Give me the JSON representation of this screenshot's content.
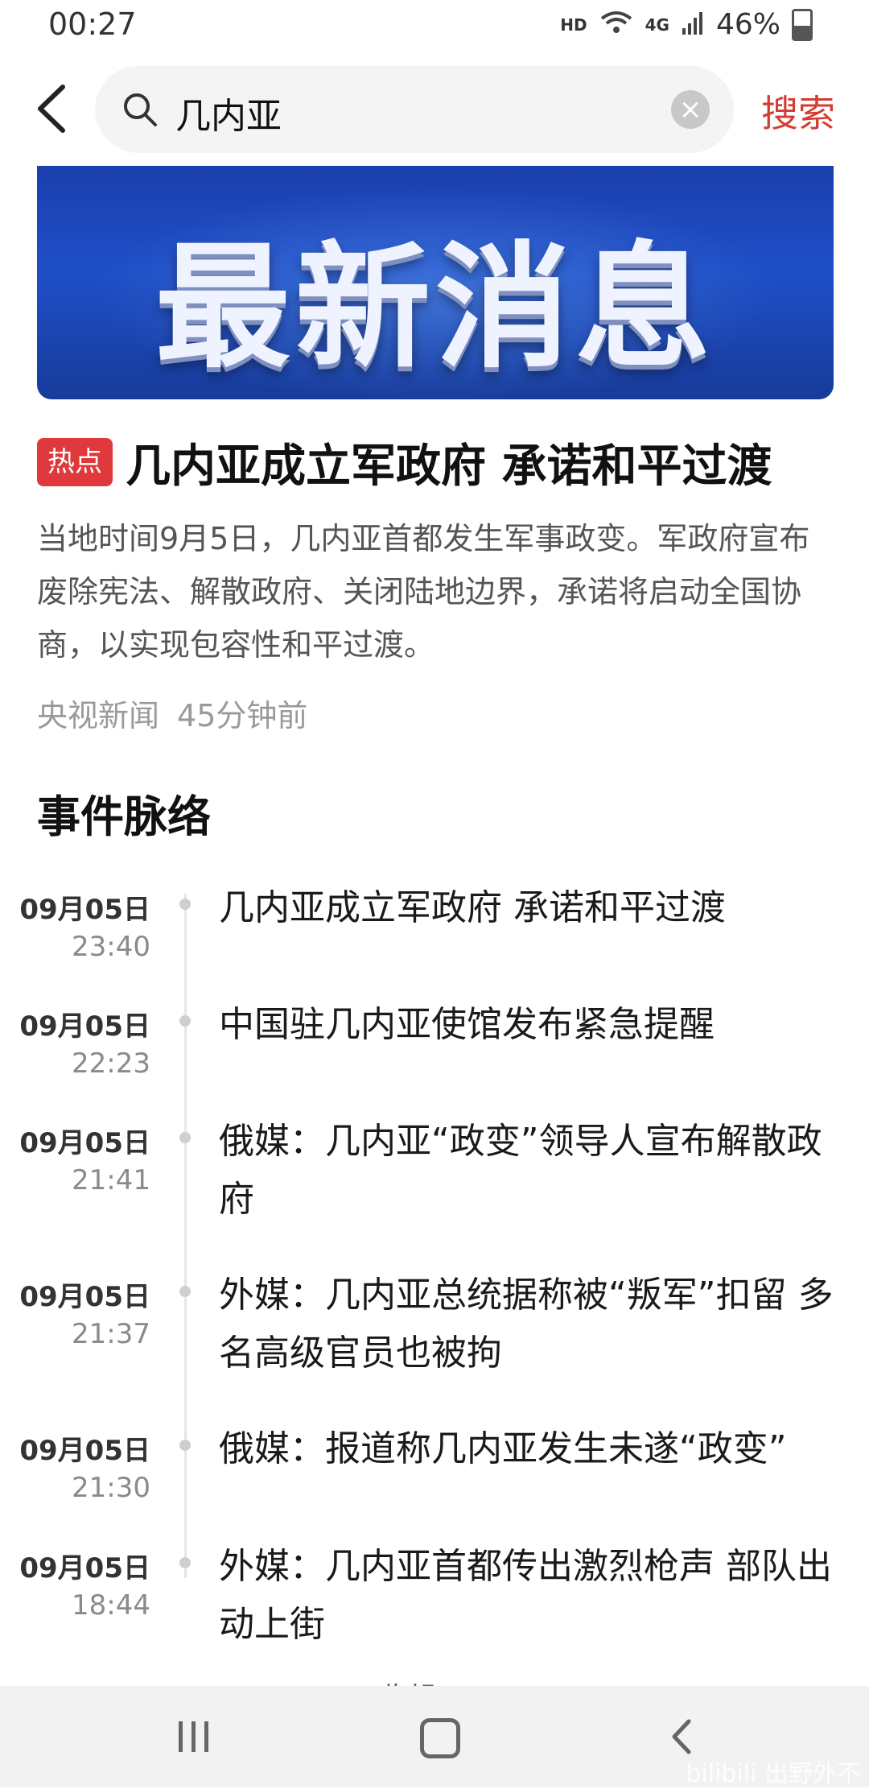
{
  "status_bar": {
    "time": "00:27",
    "network": "HD",
    "signal": "4G",
    "battery": "46%"
  },
  "search": {
    "query": "几内亚",
    "button_label": "搜索"
  },
  "banner": {
    "text": "最新消息"
  },
  "article": {
    "badge": "热点",
    "headline": "几内亚成立军政府 承诺和平过渡",
    "summary": "当地时间9月5日，几内亚首都发生军事政变。军政府宣布废除宪法、解散政府、关闭陆地边界，承诺将启动全国协商，以实现包容性和平过渡。",
    "source": "央视新闻",
    "time_ago": "45分钟前"
  },
  "timeline": {
    "title": "事件脉络",
    "items": [
      {
        "date": "09月05日",
        "time": "23:40",
        "title": "几内亚成立军政府 承诺和平过渡"
      },
      {
        "date": "09月05日",
        "time": "22:23",
        "title": "中国驻几内亚使馆发布紧急提醒"
      },
      {
        "date": "09月05日",
        "time": "21:41",
        "title": "俄媒：几内亚“政变”领导人宣布解散政府"
      },
      {
        "date": "09月05日",
        "time": "21:37",
        "title": "外媒：几内亚总统据称被“叛军”扣留 多名高级官员也被拘"
      },
      {
        "date": "09月05日",
        "time": "21:30",
        "title": "俄媒：报道称几内亚发生未遂“政变”"
      },
      {
        "date": "09月05日",
        "time": "18:44",
        "title": "外媒：几内亚首都传出激烈枪声 部队出动上街"
      }
    ],
    "collapse_label": "收起"
  },
  "watermark": "bilibili 出野外不"
}
